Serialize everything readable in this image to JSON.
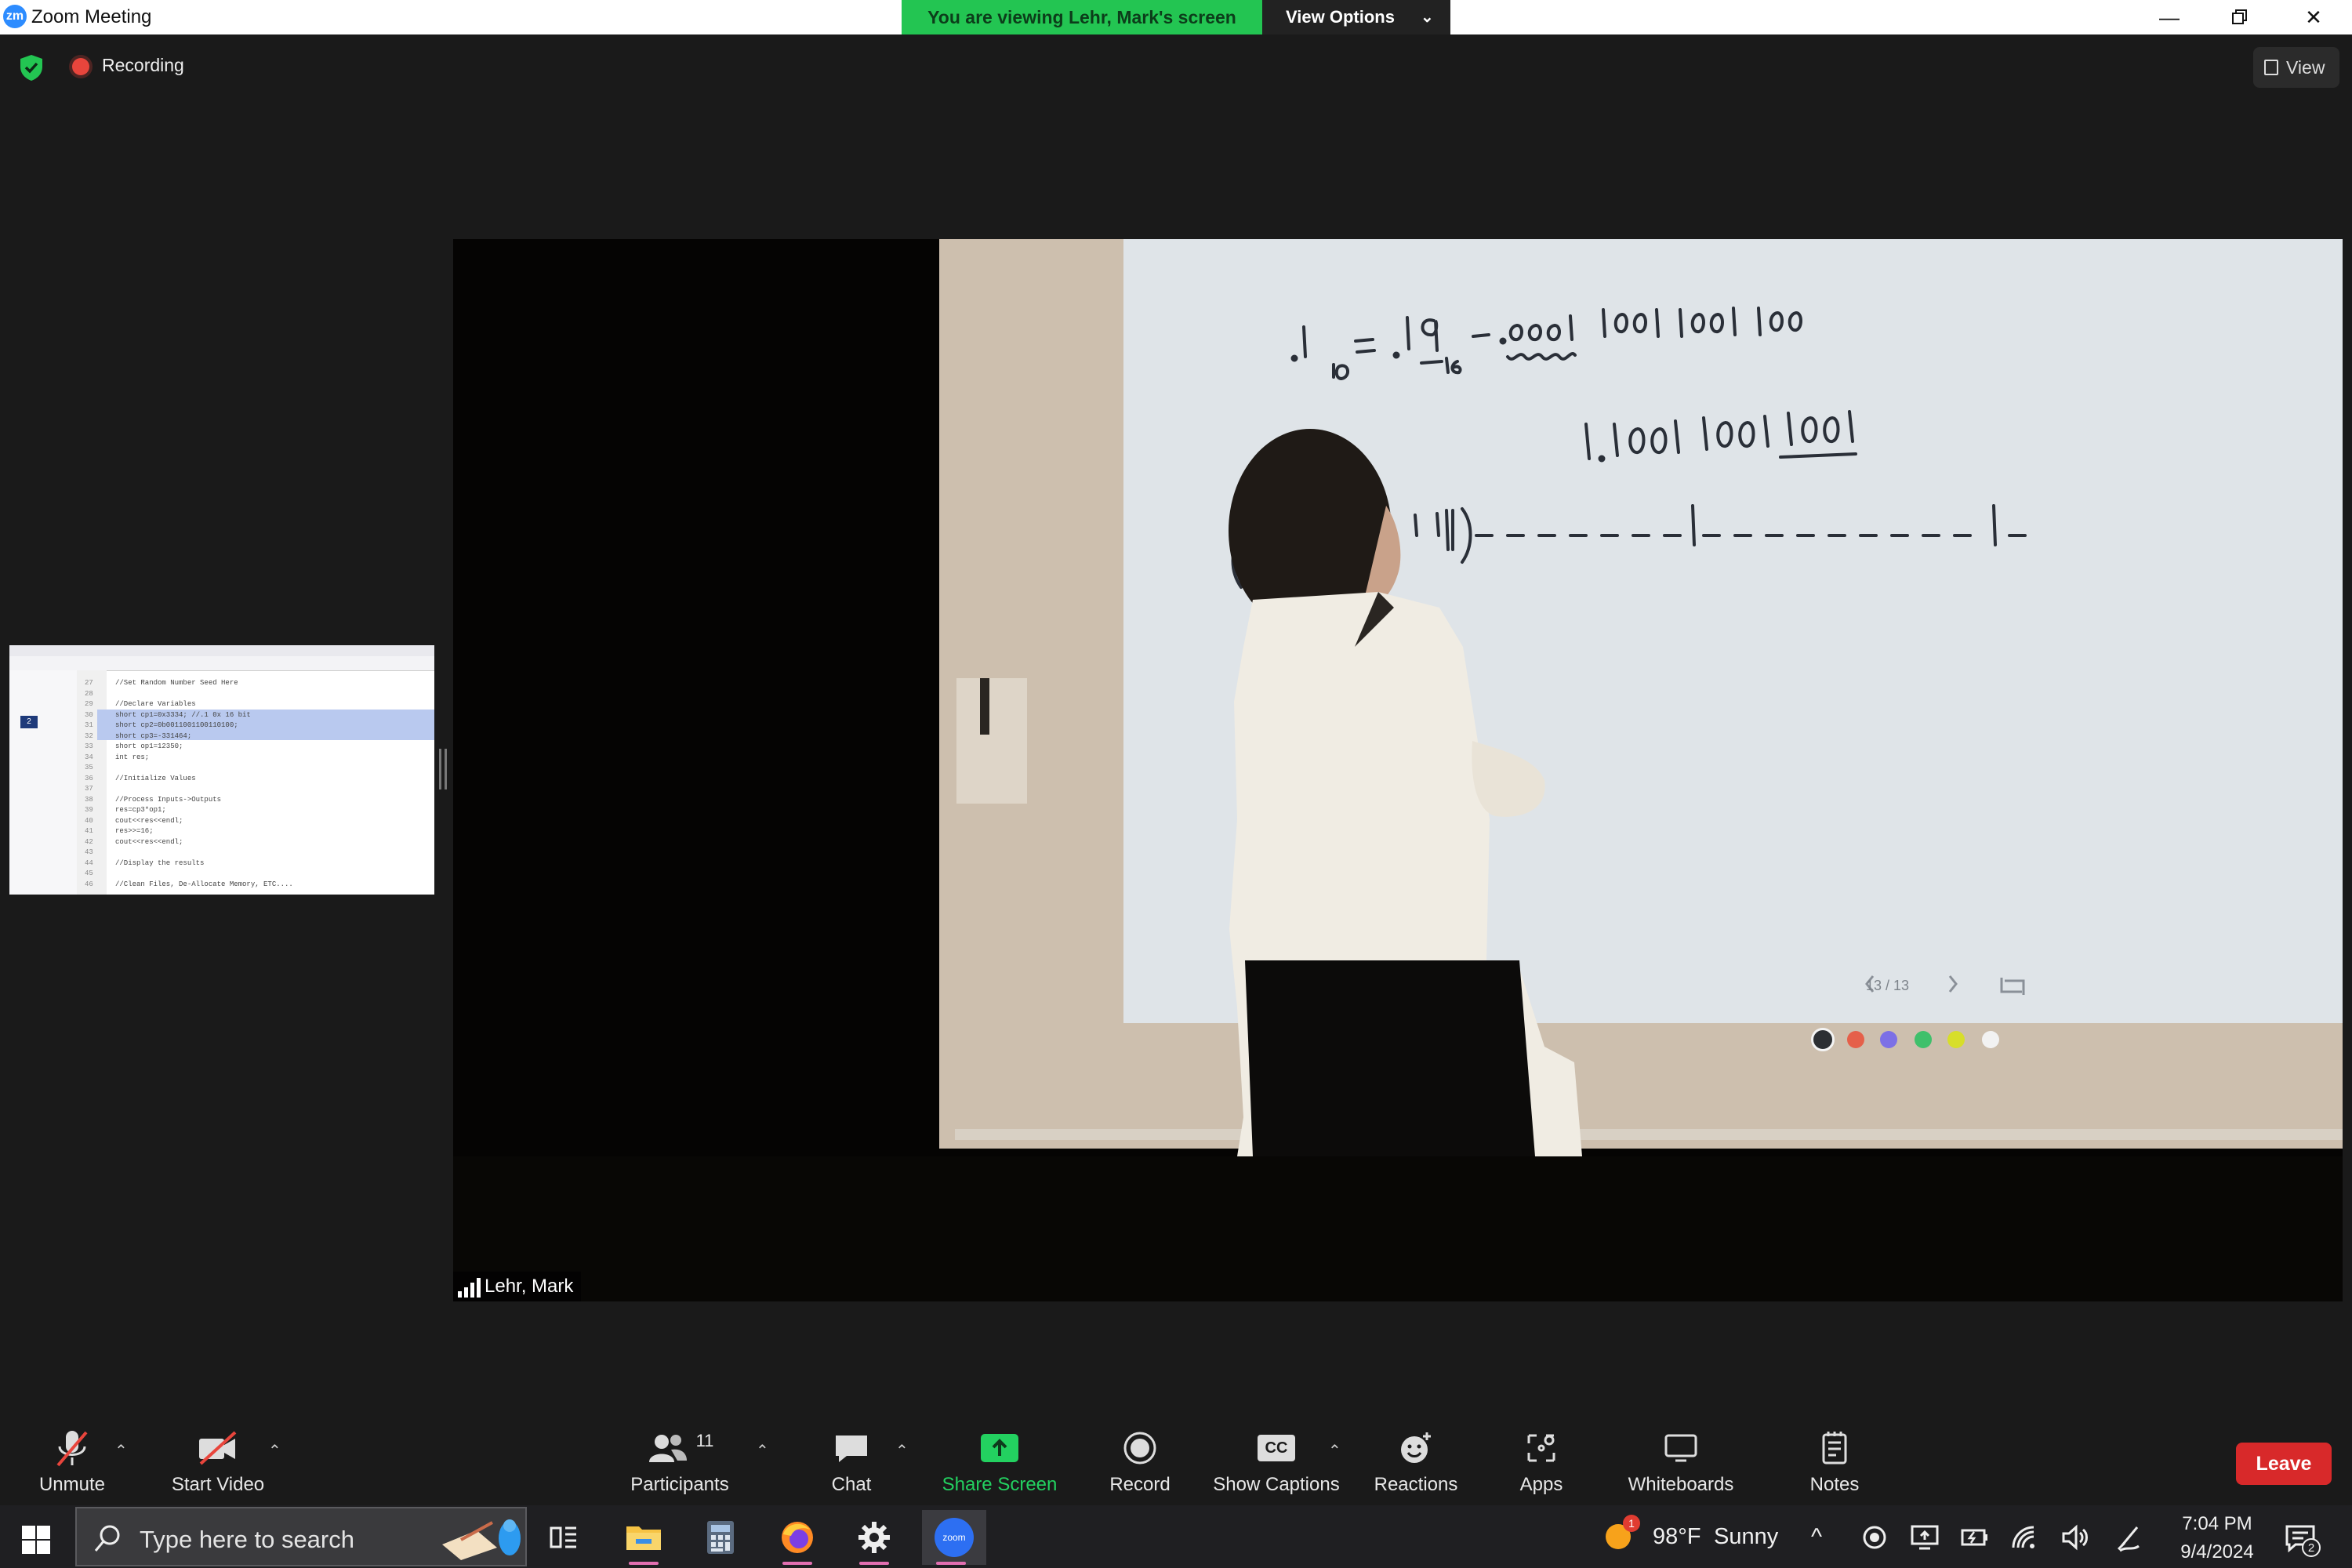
{
  "window": {
    "title": "Zoom Meeting",
    "logo_text": "zm",
    "controls": [
      "minimize-icon",
      "restore-icon",
      "close-icon"
    ]
  },
  "share_banner": {
    "viewing_text": "You are viewing Lehr, Mark's screen",
    "view_options_label": "View Options"
  },
  "meeting_top": {
    "recording_label": "Recording",
    "view_button_label": "View"
  },
  "video": {
    "participant_name": "Lehr, Mark",
    "whiteboard_lines": [
      ".1₁₀ = .19₁₆ = .0001 1001 1001 100",
      "1.1001 1001 1001"
    ],
    "page_counter": "13 / 13",
    "pen_colors": [
      "#e8e8e8",
      "#e5604a",
      "#7c70e6",
      "#3fc06b",
      "#d7de2a",
      "#f2f2f2"
    ]
  },
  "thumbnail": {
    "code_lines": [
      "//Set Random Number Seed Here",
      "",
      "//Declare Variables",
      "short cp1=0x3334; //.1 0x 16 bit",
      "short cp2=0b0011001100110100;",
      "short cp3=-331464;",
      "short op1=12350;",
      "int res;",
      "",
      "//Initialize Values",
      "",
      "//Process Inputs->Outputs",
      "res=cp3*op1;",
      "cout<<res<<endl;",
      "res>>=16;",
      "cout<<res<<endl;",
      "",
      "//Display the results",
      "",
      "//Clean Files, De-Allocate Memory, ETC...."
    ],
    "line_numbers": [
      "27",
      "28",
      "29",
      "30",
      "31",
      "32",
      "33",
      "34",
      "35",
      "36",
      "37",
      "38",
      "39",
      "40",
      "41",
      "42",
      "43",
      "44",
      "45",
      "46"
    ],
    "badge": "2"
  },
  "toolbar": {
    "unmute": "Unmute",
    "start_video": "Start Video",
    "participants": "Participants",
    "participants_count": "11",
    "chat": "Chat",
    "share_screen": "Share Screen",
    "record": "Record",
    "show_captions": "Show Captions",
    "reactions": "Reactions",
    "apps": "Apps",
    "whiteboards": "Whiteboards",
    "notes": "Notes",
    "leave": "Leave",
    "captions_badge": "CC"
  },
  "taskbar": {
    "search_placeholder": "Type here to search",
    "weather_temp": "98°F",
    "weather_cond": "Sunny",
    "weather_badge": "1",
    "time": "7:04 PM",
    "date": "9/4/2024",
    "notification_count": "2",
    "zoom_app_label": "zoom"
  },
  "colors": {
    "zoom_blue": "#2d8cff",
    "share_green": "#23c552",
    "leave_red": "#d8292a",
    "taskbar_indicator": "#e26fb1"
  }
}
